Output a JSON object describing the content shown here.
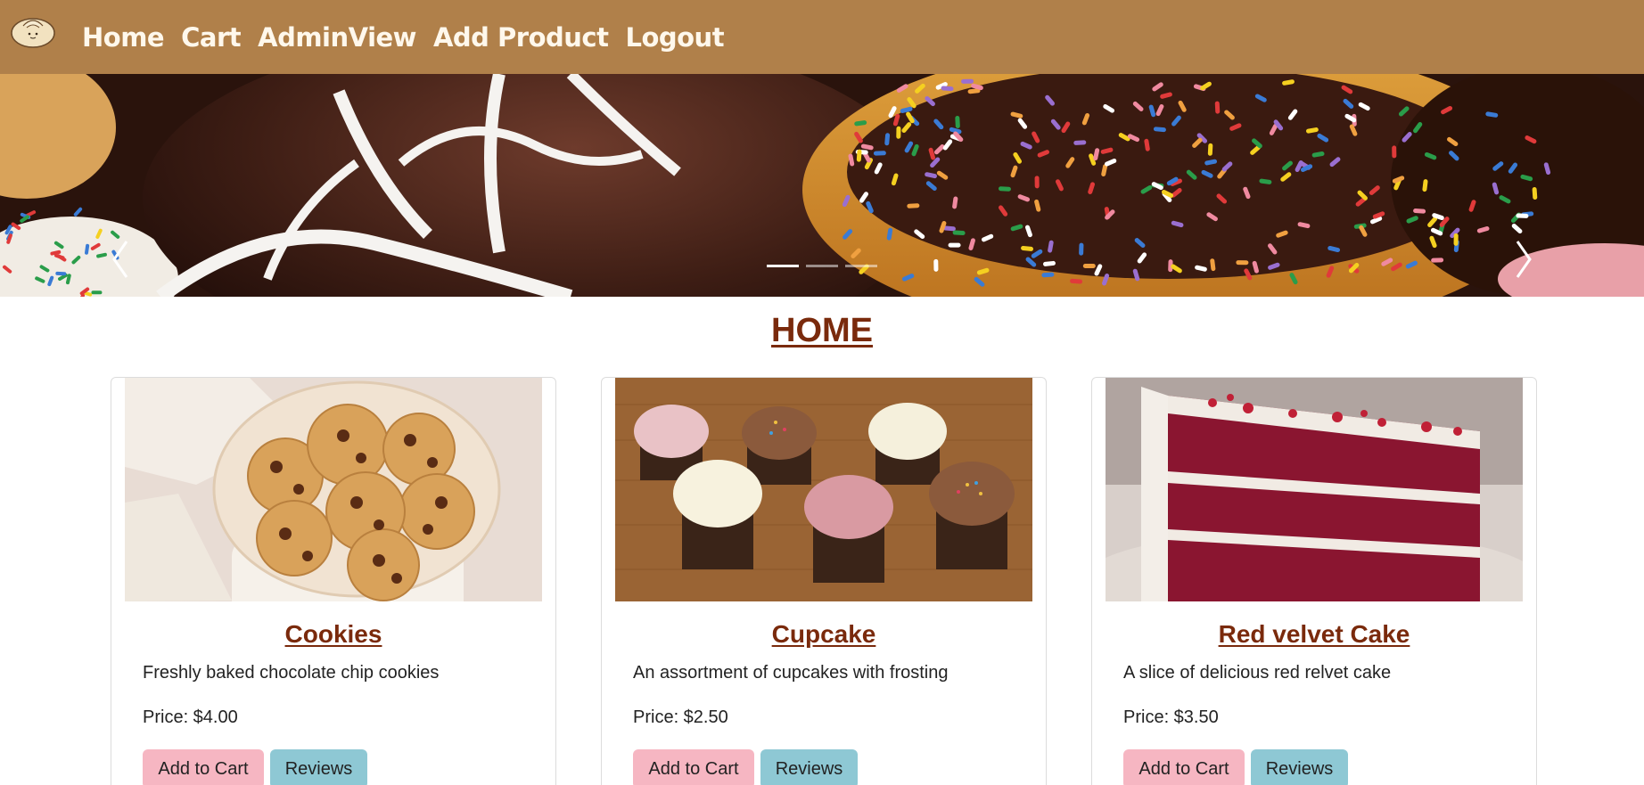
{
  "nav": {
    "logo_icon": "bun-logo-icon",
    "links": [
      "Home",
      "Cart",
      "AdminView",
      "Add Product",
      "Logout"
    ],
    "bg_color": "#b0804a"
  },
  "carousel": {
    "prev_icon": "chevron-left-icon",
    "next_icon": "chevron-right-icon",
    "slide_count": 3,
    "active_index": 0
  },
  "page": {
    "title": "HOME",
    "accent_color": "#7a2a0c"
  },
  "products": [
    {
      "title": "Cookies",
      "description": "Freshly baked chocolate chip cookies",
      "price": "Price: $4.00",
      "add_label": "Add to Cart",
      "reviews_label": "Reviews"
    },
    {
      "title": "Cupcake",
      "description": "An assortment of cupcakes with frosting",
      "price": "Price: $2.50",
      "add_label": "Add to Cart",
      "reviews_label": "Reviews"
    },
    {
      "title": "Red velvet Cake",
      "description": "A slice of delicious red relvet cake",
      "price": "Price: $3.50",
      "add_label": "Add to Cart",
      "reviews_label": "Reviews"
    }
  ],
  "button_colors": {
    "cart": "#f6b6c2",
    "reviews": "#8ec8d4"
  }
}
